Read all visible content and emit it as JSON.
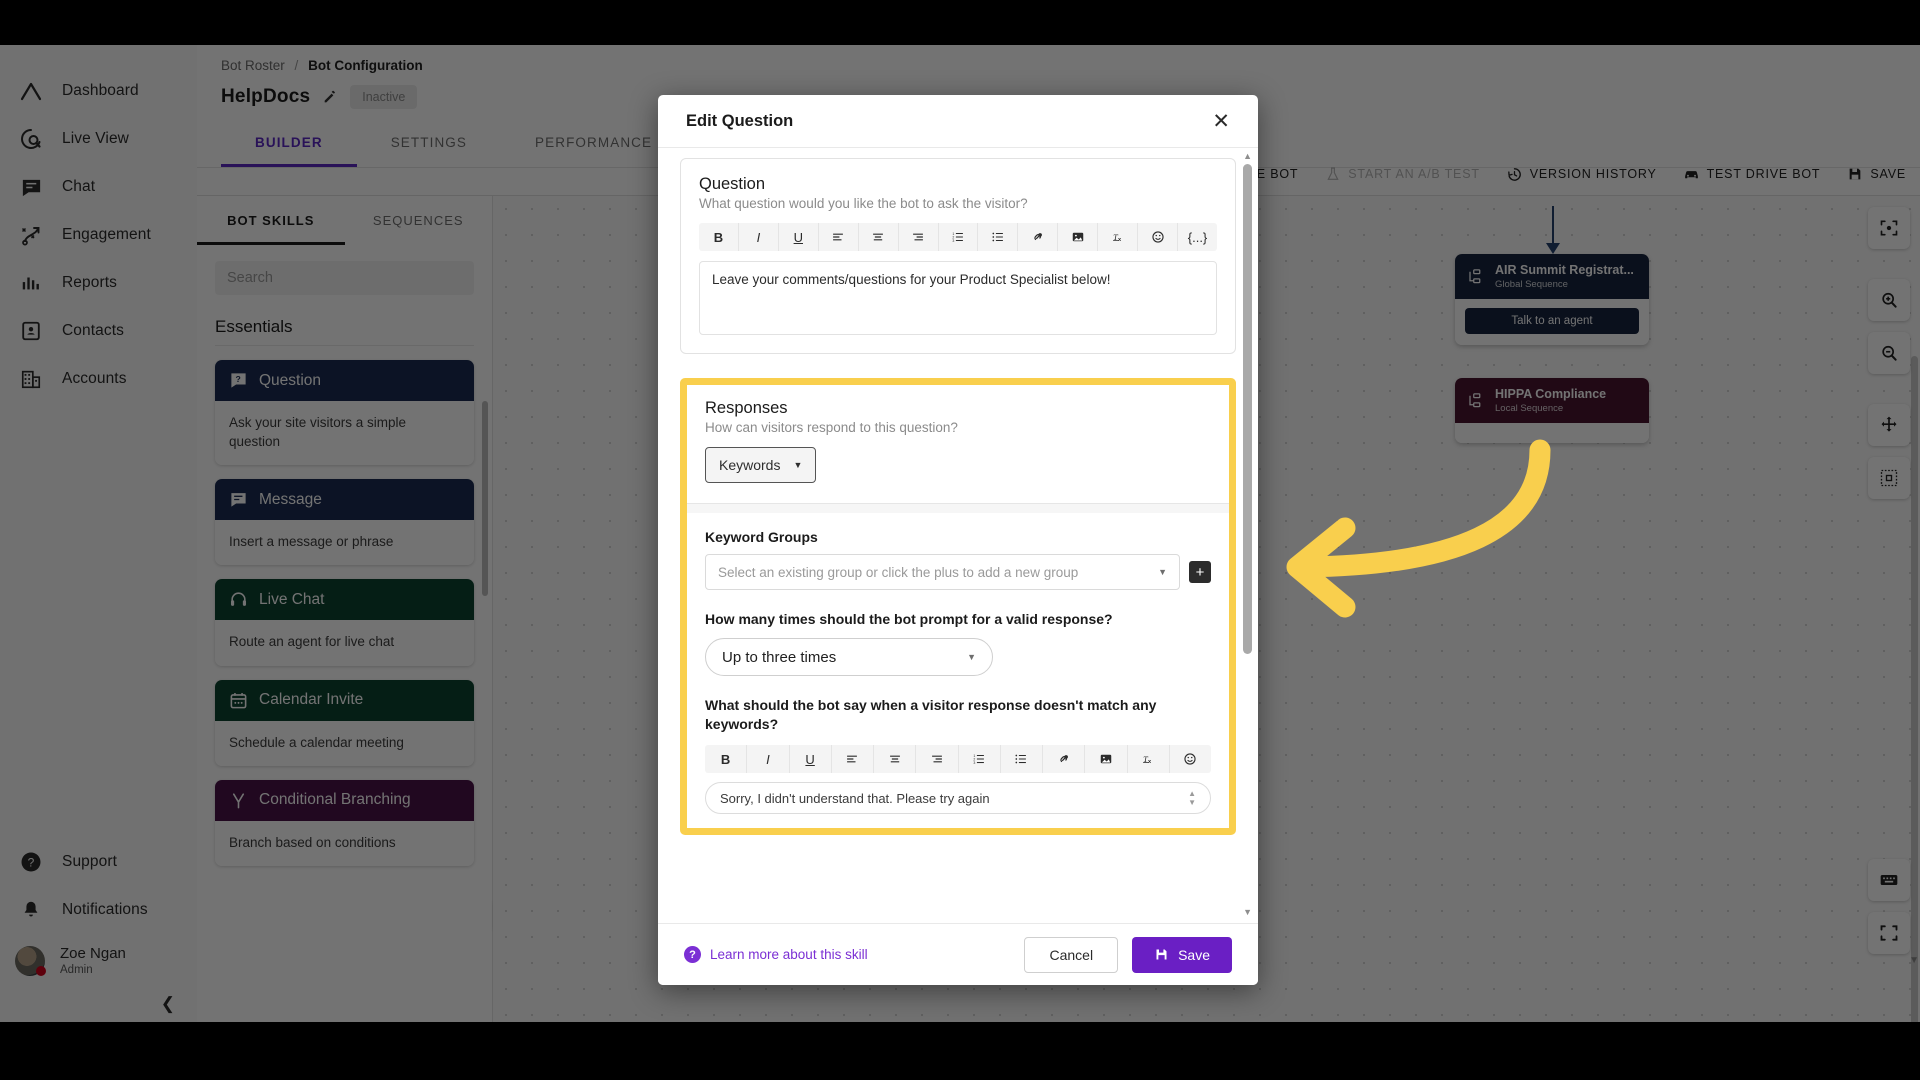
{
  "sidebar": {
    "items": [
      {
        "label": "Dashboard",
        "icon": "dashboard-icon"
      },
      {
        "label": "Live View",
        "icon": "live-view-icon"
      },
      {
        "label": "Chat",
        "icon": "chat-icon"
      },
      {
        "label": "Engagement",
        "icon": "engagement-icon"
      },
      {
        "label": "Reports",
        "icon": "reports-icon"
      },
      {
        "label": "Contacts",
        "icon": "contacts-icon"
      },
      {
        "label": "Accounts",
        "icon": "accounts-icon"
      }
    ],
    "bottom": [
      {
        "label": "Support",
        "icon": "help-circle-icon"
      },
      {
        "label": "Notifications",
        "icon": "bell-icon"
      }
    ],
    "user": {
      "name": "Zoe Ngan",
      "role": "Admin"
    },
    "collapse_icon": "chevron-left-icon"
  },
  "header": {
    "breadcrumb_root": "Bot Roster",
    "breadcrumb_sep": "/",
    "breadcrumb_current": "Bot Configuration",
    "bot_name": "HelpDocs",
    "status_badge": "Inactive",
    "tabs": [
      {
        "label": "BUILDER",
        "active": true
      },
      {
        "label": "SETTINGS",
        "active": false
      },
      {
        "label": "PERFORMANCE",
        "active": false
      }
    ],
    "actions": [
      {
        "label": "HIVE BOT",
        "icon": "archive-icon",
        "dim": false
      },
      {
        "label": "START AN A/B TEST",
        "icon": "flask-icon",
        "dim": true
      },
      {
        "label": "VERSION HISTORY",
        "icon": "history-icon",
        "dim": false
      },
      {
        "label": "TEST DRIVE BOT",
        "icon": "car-icon",
        "dim": false
      },
      {
        "label": "SAVE",
        "icon": "save-icon",
        "dim": false
      }
    ]
  },
  "skill_panel": {
    "tabs": [
      {
        "label": "BOT SKILLS",
        "active": true
      },
      {
        "label": "SEQUENCES",
        "active": false
      }
    ],
    "search_placeholder": "Search",
    "group_title": "Essentials",
    "skills": [
      {
        "title": "Question",
        "desc": "Ask your site visitors a simple question",
        "color": "#1b2c52",
        "icon": "question-box-icon"
      },
      {
        "title": "Message",
        "desc": "Insert a message or phrase",
        "color": "#1b2c52",
        "icon": "message-icon"
      },
      {
        "title": "Live Chat",
        "desc": "Route an agent for live chat",
        "color": "#0c4330",
        "icon": "headset-icon"
      },
      {
        "title": "Calendar Invite",
        "desc": "Schedule a calendar meeting",
        "color": "#0c4330",
        "icon": "calendar-icon"
      },
      {
        "title": "Conditional Branching",
        "desc": "Branch based on conditions",
        "color": "#4a1348",
        "icon": "branch-icon"
      }
    ],
    "collapse_icon": "chevron-left-icon"
  },
  "canvas": {
    "nodes": [
      {
        "title": "AIR Summit Registrat...",
        "subtitle": "Global Sequence",
        "color": "#17243f",
        "icon": "sequence-icon",
        "pill": "Talk to an agent"
      },
      {
        "title": "HIPPA Compliance",
        "subtitle": "Local Sequence",
        "color": "#4a1530",
        "icon": "sequence-icon",
        "pill": ""
      }
    ],
    "tools": [
      {
        "icon": "focus-target-icon"
      },
      {
        "icon": "zoom-in-icon"
      },
      {
        "icon": "zoom-out-icon"
      },
      {
        "icon": "move-icon"
      },
      {
        "icon": "minimap-icon"
      }
    ],
    "tools_bottom": [
      {
        "icon": "keyboard-icon"
      },
      {
        "icon": "fullscreen-icon"
      }
    ]
  },
  "modal": {
    "title": "Edit Question",
    "close_icon": "close-icon",
    "question": {
      "heading": "Question",
      "subheading": "What question would you like the bot to ask the visitor?",
      "toolbar": [
        "B",
        "I",
        "U",
        "align-left-icon",
        "align-center-icon",
        "align-right-icon",
        "ordered-list-icon",
        "bullet-list-icon",
        "link-icon",
        "image-icon",
        "clear-format-icon",
        "emoji-icon",
        "{...}"
      ],
      "value": "Leave your comments/questions for your Product Specialist below!"
    },
    "responses": {
      "heading": "Responses",
      "subheading": "How can visitors respond to this question?",
      "type_value": "Keywords",
      "keyword_groups_label": "Keyword Groups",
      "keyword_groups_placeholder": "Select an existing group or click the plus to add a new group",
      "add_group_icon": "plus-icon",
      "prompt_label": "How many times should the bot prompt for a valid response?",
      "prompt_value": "Up to three times",
      "fallback_label": "What should the bot say when a visitor response doesn't match any keywords?",
      "fallback_toolbar": [
        "B",
        "I",
        "U",
        "align-left-icon",
        "align-center-icon",
        "align-right-icon",
        "ordered-list-icon",
        "bullet-list-icon",
        "link-icon",
        "image-icon",
        "clear-format-icon",
        "emoji-icon"
      ],
      "fallback_value": "Sorry, I didn't understand that. Please try again",
      "highlight_color": "#f9cf4d"
    },
    "footer": {
      "learn_more": "Learn more about this skill",
      "learn_icon": "help-circle-icon",
      "cancel": "Cancel",
      "save": "Save",
      "save_icon": "save-icon"
    }
  },
  "annotation": {
    "arrow_color": "#f9cf4d",
    "arrow_name": "highlight-arrow"
  }
}
